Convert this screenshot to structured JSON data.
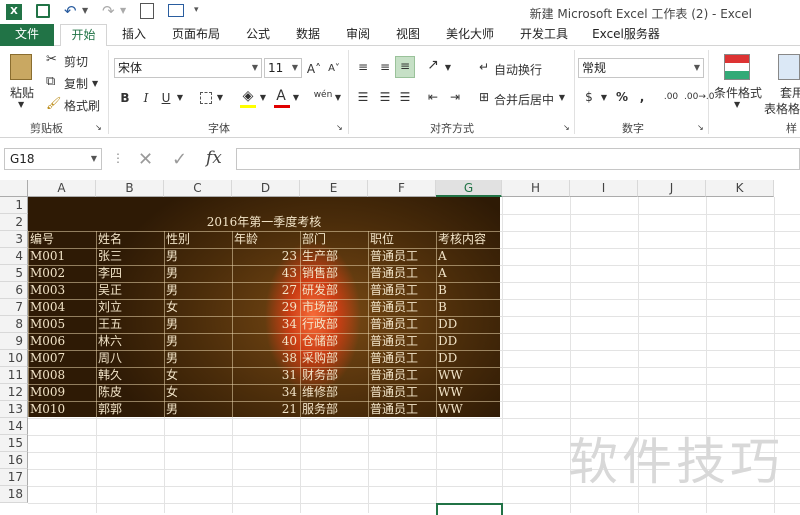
{
  "window": {
    "title": "新建 Microsoft Excel 工作表 (2) - Excel"
  },
  "tabs": [
    {
      "label": "文件"
    },
    {
      "label": "开始"
    },
    {
      "label": "插入"
    },
    {
      "label": "页面布局"
    },
    {
      "label": "公式"
    },
    {
      "label": "数据"
    },
    {
      "label": "审阅"
    },
    {
      "label": "视图"
    },
    {
      "label": "美化大师"
    },
    {
      "label": "开发工具"
    },
    {
      "label": "Excel服务器"
    }
  ],
  "ribbon": {
    "clipboard": {
      "paste": "粘贴",
      "cut": "剪切",
      "copy": "复制",
      "format_painter": "格式刷",
      "group": "剪贴板"
    },
    "font": {
      "name": "宋体",
      "size": "11",
      "grow": "A˄",
      "shrink": "A˅",
      "bold": "B",
      "italic": "I",
      "underline": "U",
      "wen": "wén",
      "font_color_letter": "A",
      "group": "字体"
    },
    "alignment": {
      "wrap": "自动换行",
      "merge": "合并后居中",
      "group": "对齐方式"
    },
    "number": {
      "format": "常规",
      "percent": "%",
      "comma": ",",
      "inc": ".00",
      "group": "数字"
    },
    "styles": {
      "conditional": "条件格式",
      "table": "套用",
      "table2": "表格格",
      "group": "样"
    }
  },
  "formula_bar": {
    "name_box": "G18",
    "fx": "fx",
    "cancel": "✕",
    "enter": "✓",
    "value": ""
  },
  "columns": [
    "A",
    "B",
    "C",
    "D",
    "E",
    "F",
    "G",
    "H",
    "I",
    "J",
    "K"
  ],
  "rows": [
    "1",
    "2",
    "3",
    "4",
    "5",
    "6",
    "7",
    "8",
    "9",
    "10",
    "11",
    "12",
    "13",
    "14",
    "15",
    "16",
    "17",
    "18"
  ],
  "sheet": {
    "title": "2016年第一季度考核",
    "headers": [
      "编号",
      "姓名",
      "性别",
      "年龄",
      "部门",
      "职位",
      "考核内容"
    ],
    "records": [
      [
        "M001",
        "张三",
        "男",
        "23",
        "生产部",
        "普通员工",
        "A"
      ],
      [
        "M002",
        "李四",
        "男",
        "43",
        "销售部",
        "普通员工",
        "A"
      ],
      [
        "M003",
        "吴正",
        "男",
        "27",
        "研发部",
        "普通员工",
        "B"
      ],
      [
        "M004",
        "刘立",
        "女",
        "29",
        "市场部",
        "普通员工",
        "B"
      ],
      [
        "M005",
        "王五",
        "男",
        "34",
        "行政部",
        "普通员工",
        "DD"
      ],
      [
        "M006",
        "林六",
        "男",
        "40",
        "仓储部",
        "普通员工",
        "DD"
      ],
      [
        "M007",
        "周八",
        "男",
        "38",
        "采购部",
        "普通员工",
        "DD"
      ],
      [
        "M008",
        "韩久",
        "女",
        "31",
        "财务部",
        "普通员工",
        "WW"
      ],
      [
        "M009",
        "陈皮",
        "女",
        "34",
        "维修部",
        "普通员工",
        "WW"
      ],
      [
        "M010",
        "郭郭",
        "男",
        "21",
        "服务部",
        "普通员工",
        "WW"
      ]
    ]
  },
  "watermark": "软件技巧",
  "colors": {
    "accent": "#217346"
  }
}
